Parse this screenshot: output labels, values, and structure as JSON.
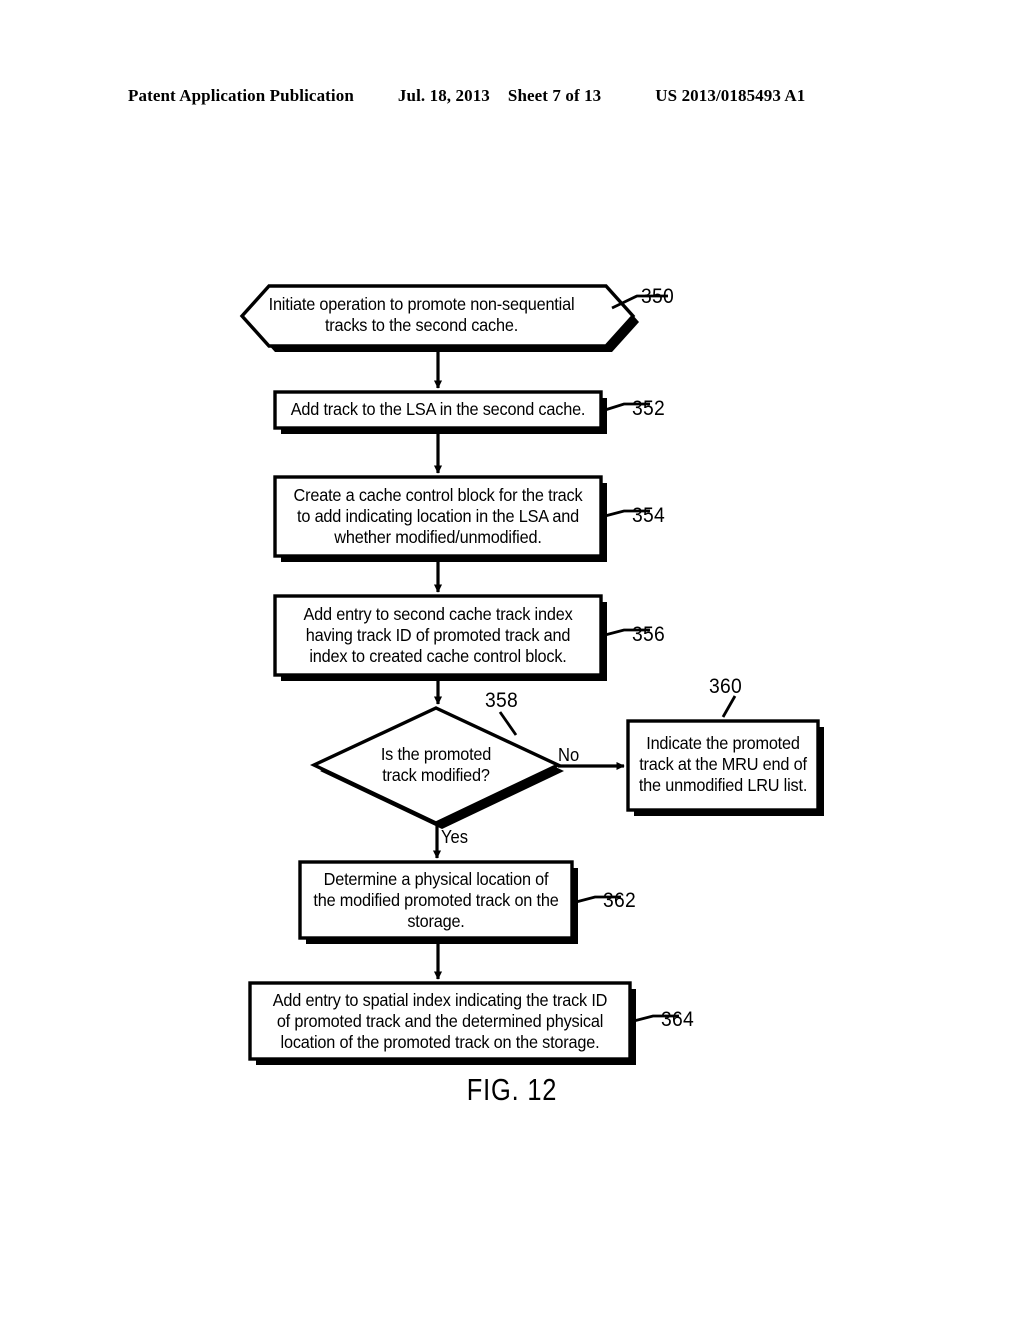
{
  "header": {
    "publication": "Patent Application Publication",
    "date": "Jul. 18, 2013",
    "sheet": "Sheet 7 of 13",
    "patent_number": "US 2013/0185493 A1"
  },
  "figure": {
    "caption": "FIG. 12",
    "nodes": [
      {
        "id": "350",
        "shape": "hexagon",
        "ref": "350",
        "text": "Initiate operation to promote non-sequential tracks to the second cache.",
        "lines": [
          "Initiate operation to promote non-sequential",
          "tracks to the second cache."
        ]
      },
      {
        "id": "352",
        "shape": "rect",
        "ref": "352",
        "text": "Add track to the LSA in the second cache.",
        "lines": [
          "Add track to the LSA in the second cache."
        ]
      },
      {
        "id": "354",
        "shape": "rect",
        "ref": "354",
        "text": "Create a cache control block for the track to add indicating location in the LSA and whether modified/unmodified.",
        "lines": [
          "Create a cache control block for the track",
          "to add indicating location in the LSA and",
          "whether modified/unmodified."
        ]
      },
      {
        "id": "356",
        "shape": "rect",
        "ref": "356",
        "text": "Add entry to second cache track index having track ID of promoted track and index to created cache control block.",
        "lines": [
          "Add entry to second cache track index",
          "having track ID of promoted track and",
          "index to created cache control block."
        ]
      },
      {
        "id": "358",
        "shape": "diamond",
        "ref": "358",
        "text": "Is the promoted track modified?",
        "lines": [
          "Is the promoted",
          "track modified?"
        ]
      },
      {
        "id": "360",
        "shape": "rect",
        "ref": "360",
        "text": "Indicate the promoted track at the MRU end of the unmodified LRU list.",
        "lines": [
          "Indicate the promoted",
          "track at the MRU end of",
          "the unmodified LRU list."
        ]
      },
      {
        "id": "362",
        "shape": "rect",
        "ref": "362",
        "text": "Determine a physical location of the modified promoted track on the storage.",
        "lines": [
          "Determine a physical location of",
          "the modified promoted track on the",
          "storage."
        ]
      },
      {
        "id": "364",
        "shape": "rect",
        "ref": "364",
        "text": "Add entry to spatial index indicating the track ID of promoted track and the determined physical location of the promoted track on the storage.",
        "lines": [
          "Add entry to spatial index indicating the track ID",
          "of promoted track and the determined physical",
          "location of the promoted track on the storage."
        ]
      }
    ],
    "edge_labels": {
      "no": "No",
      "yes": "Yes"
    }
  },
  "colors": {
    "ink": "#000000",
    "paper": "#ffffff"
  }
}
